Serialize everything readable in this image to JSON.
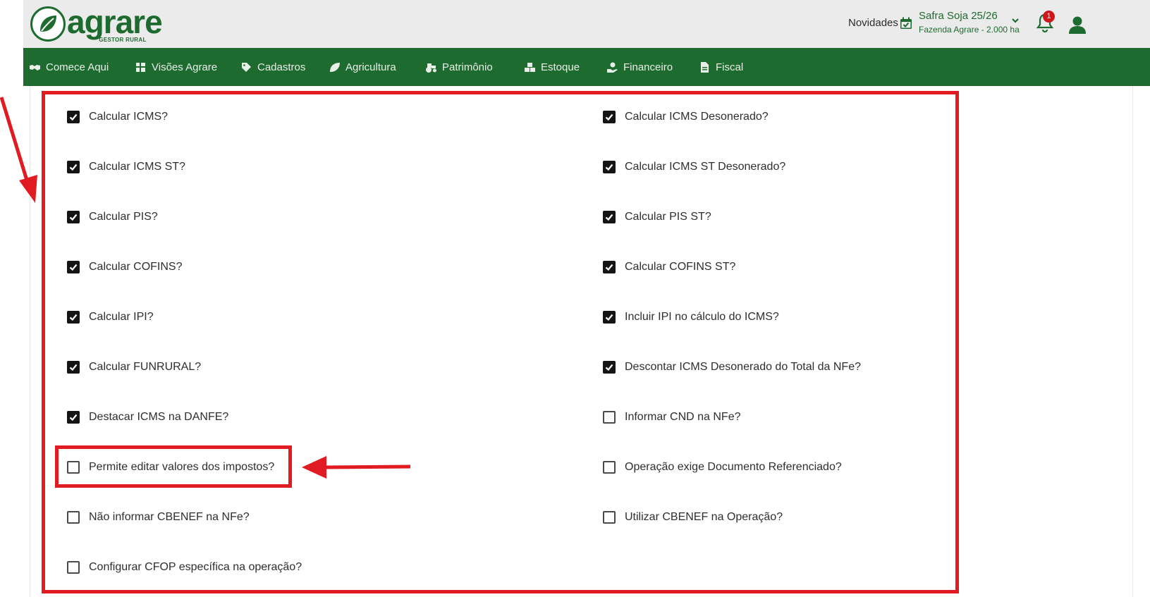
{
  "brand": {
    "name": "agrare",
    "tagline": "GESTOR RURAL",
    "color": "#1e6b2f"
  },
  "header": {
    "novidades": "Novidades",
    "safra_title": "Safra Soja 25/26",
    "safra_subtitle": "Fazenda Agrare - 2.000 ha",
    "notifications_count": "1",
    "icons": [
      "calendar-check-icon",
      "chevron-down-icon",
      "bell-icon",
      "user-icon"
    ]
  },
  "nav": {
    "items": [
      {
        "label": "Comece Aqui",
        "icon": "handshake-icon"
      },
      {
        "label": "Visões Agrare",
        "icon": "grid-icon"
      },
      {
        "label": "Cadastros",
        "icon": "tag-icon"
      },
      {
        "label": "Agricultura",
        "icon": "leaf-icon"
      },
      {
        "label": "Patrimônio",
        "icon": "tractor-icon"
      },
      {
        "label": "Estoque",
        "icon": "boxes-icon"
      },
      {
        "label": "Financeiro",
        "icon": "money-hand-icon"
      },
      {
        "label": "Fiscal",
        "icon": "file-invoice-icon"
      }
    ]
  },
  "options": {
    "left": [
      {
        "label": "Calcular ICMS?",
        "checked": true
      },
      {
        "label": "Calcular ICMS ST?",
        "checked": true
      },
      {
        "label": "Calcular PIS?",
        "checked": true
      },
      {
        "label": "Calcular COFINS?",
        "checked": true
      },
      {
        "label": "Calcular IPI?",
        "checked": true
      },
      {
        "label": "Calcular FUNRURAL?",
        "checked": true
      },
      {
        "label": "Destacar ICMS na DANFE?",
        "checked": true
      },
      {
        "label": "Permite editar valores dos impostos?",
        "checked": false
      },
      {
        "label": "Não informar CBENEF na NFe?",
        "checked": false
      },
      {
        "label": "Configurar CFOP específica na operação?",
        "checked": false
      }
    ],
    "right": [
      {
        "label": "Calcular ICMS Desonerado?",
        "checked": true
      },
      {
        "label": "Calcular ICMS ST Desonerado?",
        "checked": true
      },
      {
        "label": "Calcular PIS ST?",
        "checked": true
      },
      {
        "label": "Calcular COFINS ST?",
        "checked": true
      },
      {
        "label": "Incluir IPI no cálculo do ICMS?",
        "checked": true
      },
      {
        "label": "Descontar ICMS Desonerado do Total da NFe?",
        "checked": true
      },
      {
        "label": "Informar CND na NFe?",
        "checked": false
      },
      {
        "label": "Operação exige Documento Referenciado?",
        "checked": false
      },
      {
        "label": "Utilizar CBENEF na Operação?",
        "checked": false
      }
    ]
  },
  "annotation_color": "#e01b22"
}
